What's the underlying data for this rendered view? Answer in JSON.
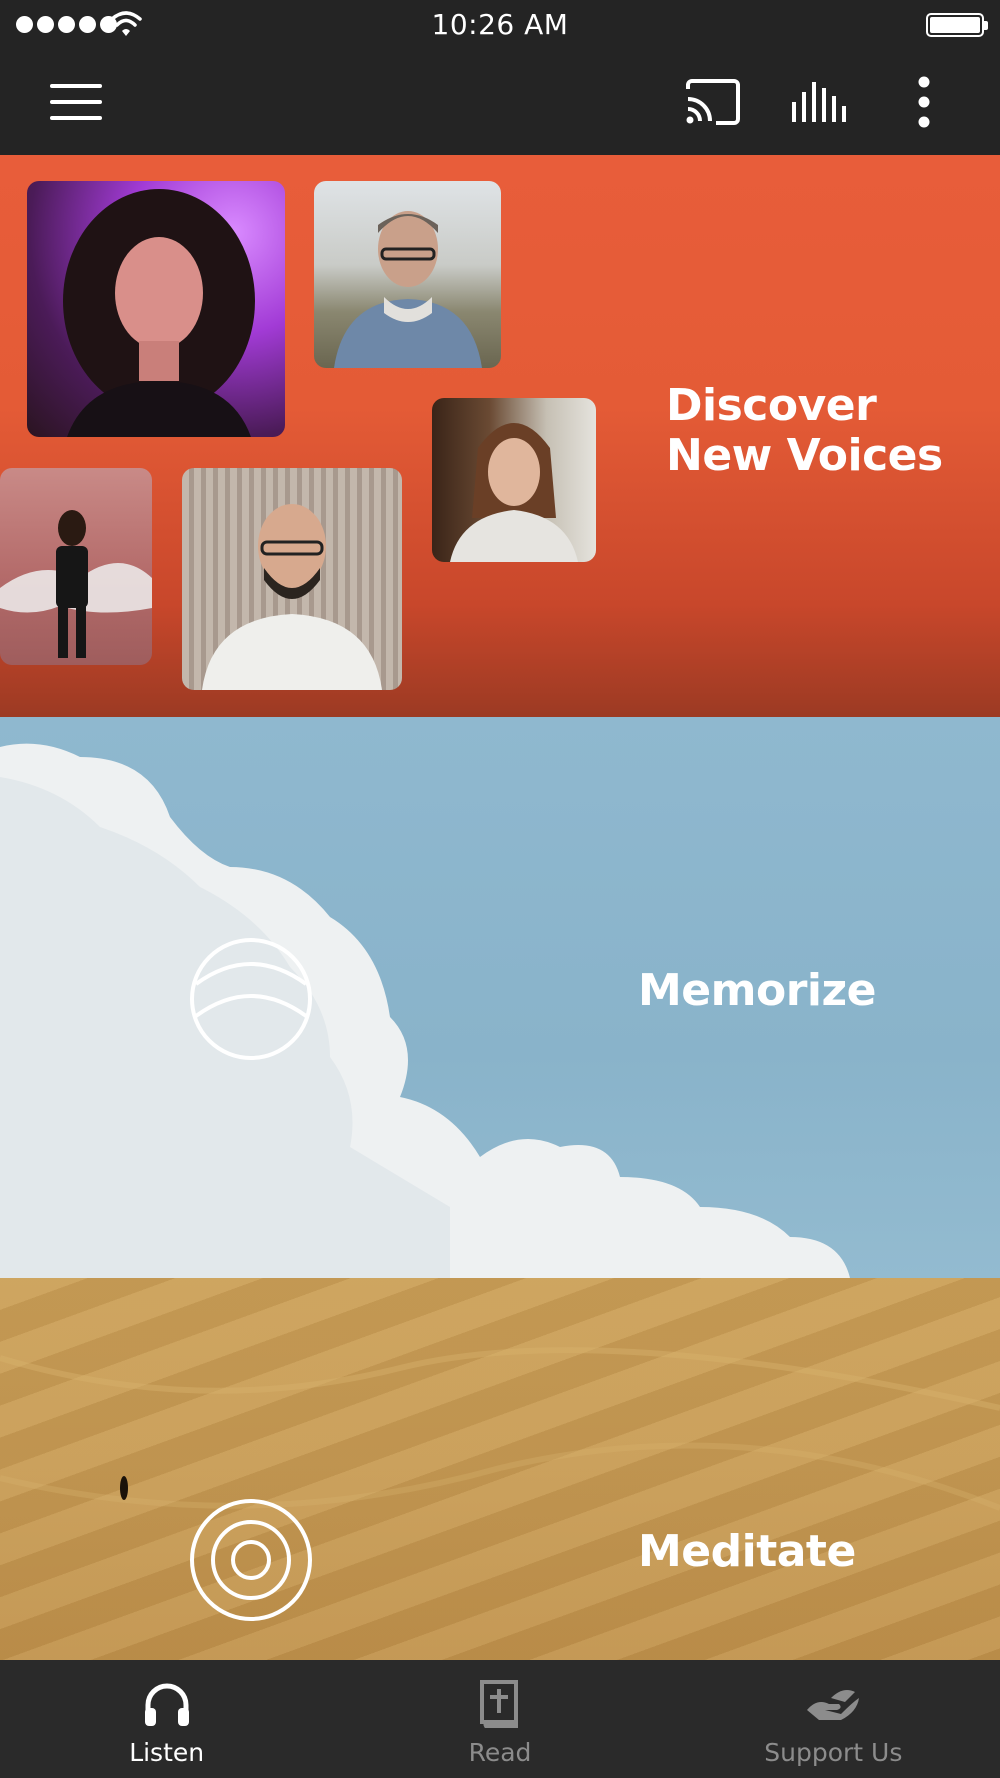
{
  "status_bar": {
    "time": "10:26 AM",
    "signal_icon": "signal-dots-icon",
    "wifi_icon": "wifi-icon",
    "battery_icon": "battery-full-icon"
  },
  "app_bar": {
    "menu_icon": "hamburger-menu-icon",
    "cast_icon": "cast-icon",
    "equalizer_icon": "equalizer-icon",
    "more_icon": "more-vertical-icon"
  },
  "panels": [
    {
      "id": "discover",
      "title_line1": "Discover",
      "title_line2": "New Voices",
      "background": "#e85d3a"
    },
    {
      "id": "memorize",
      "title": "Memorize",
      "icon": "memorize-circle-icon",
      "background": "#8fb8cf"
    },
    {
      "id": "meditate",
      "title": "Meditate",
      "icon": "meditate-rings-icon",
      "background": "#c99e58"
    }
  ],
  "bottom_nav": {
    "items": [
      {
        "label": "Listen",
        "icon": "headphones-icon",
        "active": true
      },
      {
        "label": "Read",
        "icon": "bible-book-icon",
        "active": false
      },
      {
        "label": "Support Us",
        "icon": "giving-hand-icon",
        "active": false
      }
    ]
  },
  "colors": {
    "bar_background": "#242424",
    "nav_background": "#2a2a2a",
    "active": "#ffffff",
    "inactive": "#8c8c8c"
  }
}
